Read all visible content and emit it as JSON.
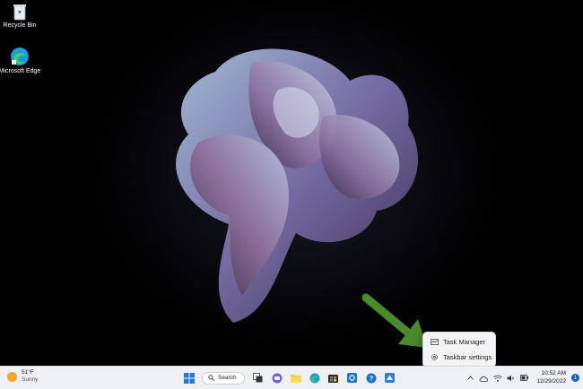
{
  "desktop": {
    "icons": [
      {
        "label": "Recycle Bin",
        "icon": "recycle-bin-icon"
      },
      {
        "label": "Microsoft Edge",
        "icon": "edge-icon"
      }
    ]
  },
  "context_menu": {
    "items": [
      {
        "label": "Task Manager",
        "icon": "task-manager-icon"
      },
      {
        "label": "Taskbar settings",
        "icon": "gear-icon"
      }
    ]
  },
  "taskbar": {
    "weather": {
      "temp": "51°F",
      "condition": "Sunny"
    },
    "search_label": "Search",
    "apps": [
      "start-icon",
      "search-icon",
      "task-view-icon",
      "chat-icon",
      "file-explorer-icon",
      "edge-icon",
      "store-icon",
      "app-icon",
      "help-icon",
      "app-icon"
    ],
    "clock": {
      "time": "10:52 AM",
      "date": "12/29/2022"
    },
    "notifications": "1"
  },
  "colors": {
    "accent": "#1a5fd1",
    "arrow": "#4a8a2a",
    "taskbar_bg": "#eff0f4"
  }
}
